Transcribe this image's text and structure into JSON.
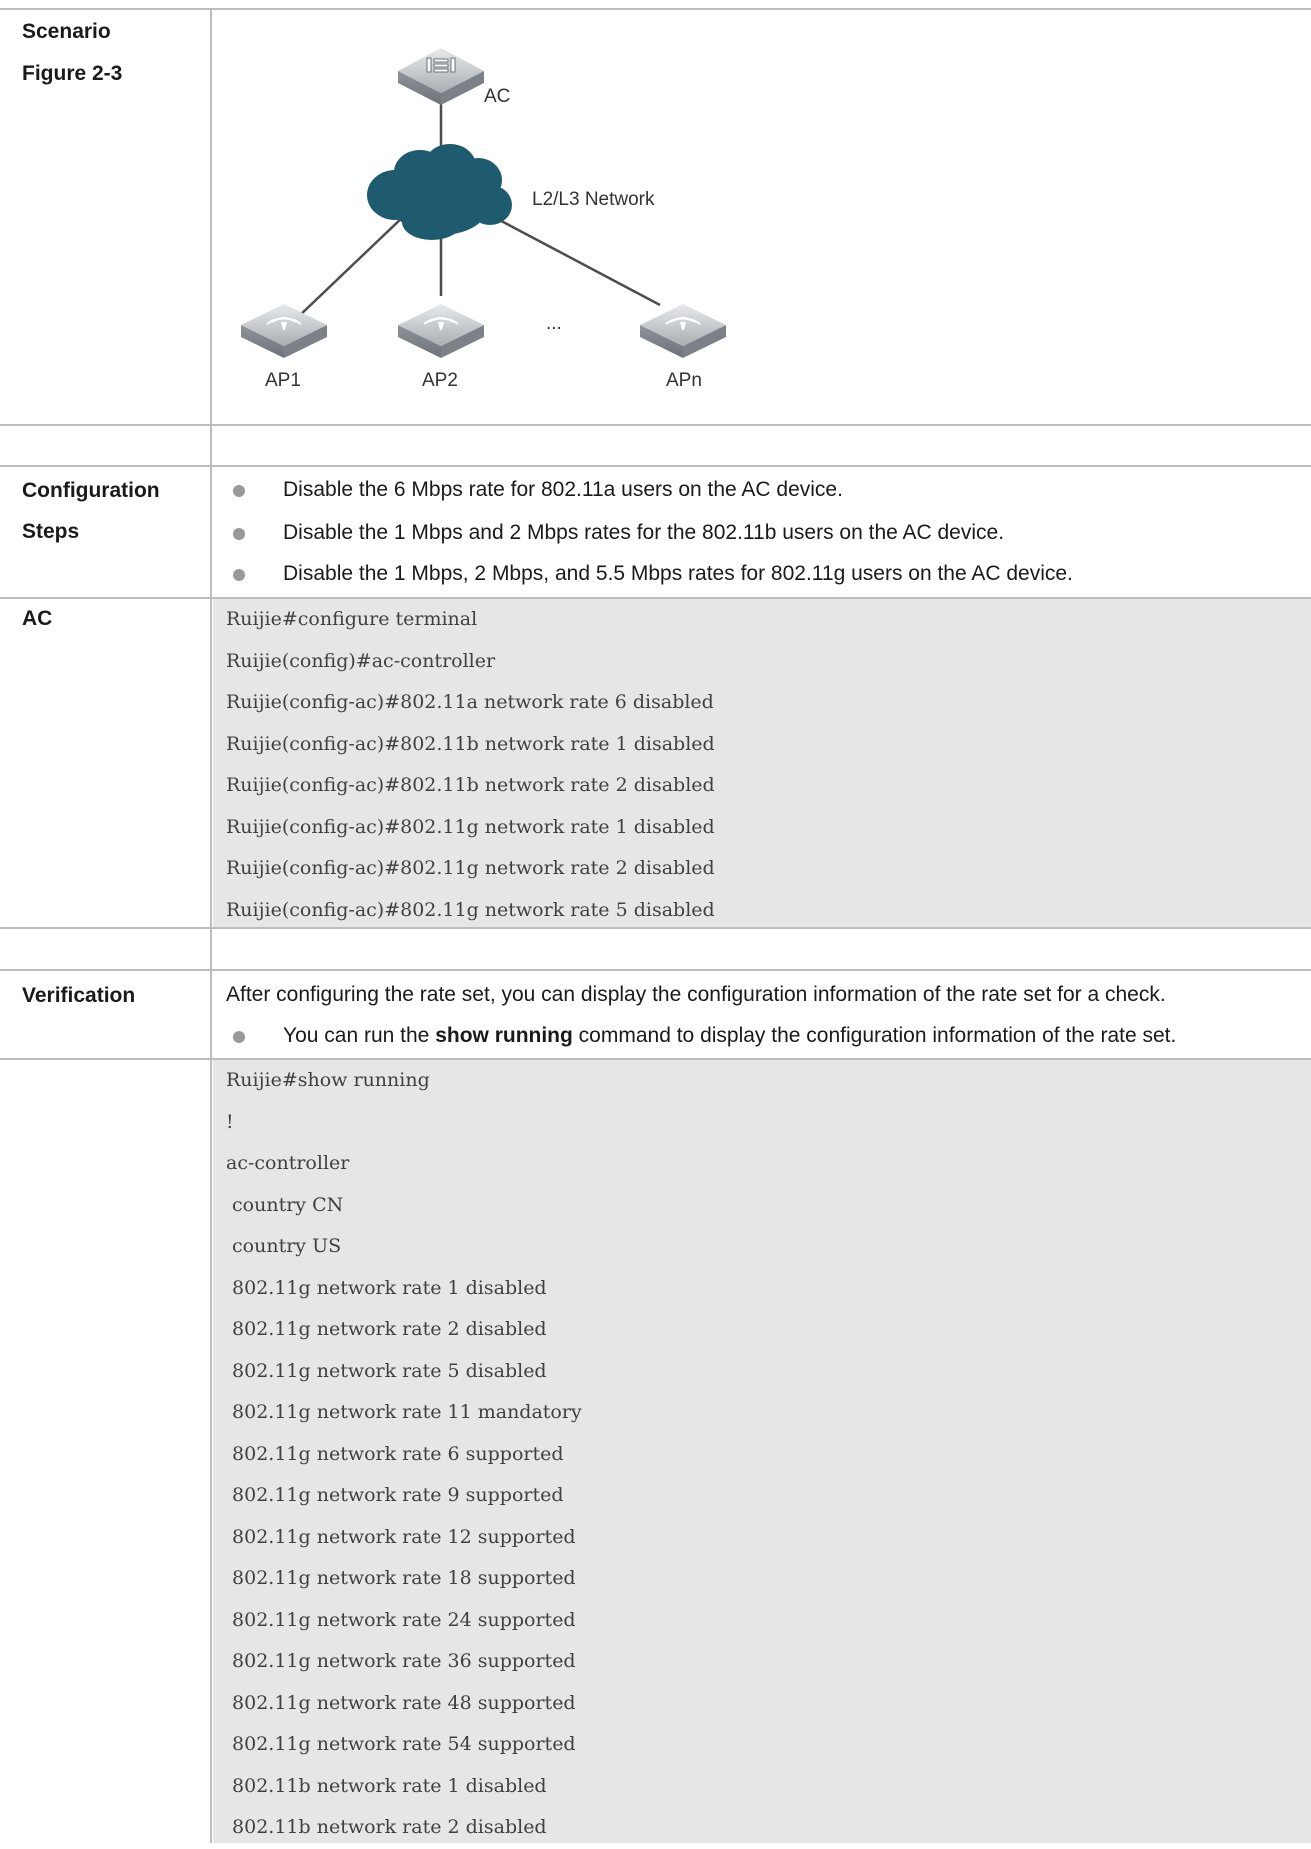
{
  "scenario": {
    "label": "Scenario",
    "figure_label": "Figure 2-3",
    "diagram": {
      "ac_label": "AC",
      "network_label": "L2/L3 Network",
      "ap_labels": [
        "AP1",
        "AP2",
        "APn"
      ],
      "ellipsis": "..."
    }
  },
  "config_steps": {
    "label_line1": "Configuration",
    "label_line2": "Steps",
    "bullets": [
      "Disable the 6 Mbps rate for 802.11a users on the AC device.",
      "Disable the 1 Mbps and 2 Mbps rates for the 802.11b users on the AC device.",
      "Disable the 1 Mbps, 2 Mbps, and 5.5 Mbps rates for 802.11g users on the AC device."
    ]
  },
  "ac": {
    "label": "AC",
    "code": [
      "Ruijie#configure terminal",
      "Ruijie(config)#ac-controller",
      "Ruijie(config-ac)#802.11a network rate 6 disabled",
      "Ruijie(config-ac)#802.11b network rate 1 disabled",
      "Ruijie(config-ac)#802.11b network rate 2 disabled",
      "Ruijie(config-ac)#802.11g network rate 1 disabled",
      "Ruijie(config-ac)#802.11g network rate 2 disabled",
      "Ruijie(config-ac)#802.11g network rate 5 disabled"
    ]
  },
  "verification": {
    "label": "Verification",
    "intro": "After configuring the rate set, you can display the configuration information of the rate set for a check.",
    "bullet_before": "You can run the ",
    "bullet_bold": "show running",
    "bullet_after": " command to display the configuration information of the rate set.",
    "code": [
      "Ruijie#show running",
      "!",
      "ac-controller",
      " country CN",
      " country US",
      " 802.11g network rate 1 disabled",
      " 802.11g network rate 2 disabled",
      " 802.11g network rate 5 disabled",
      " 802.11g network rate 11 mandatory",
      " 802.11g network rate 6 supported",
      " 802.11g network rate 9 supported",
      " 802.11g network rate 12 supported",
      " 802.11g network rate 18 supported",
      " 802.11g network rate 24 supported",
      " 802.11g network rate 36 supported",
      " 802.11g network rate 48 supported",
      " 802.11g network rate 54 supported",
      " 802.11b network rate 1 disabled",
      " 802.11b network rate 2 disabled"
    ]
  }
}
